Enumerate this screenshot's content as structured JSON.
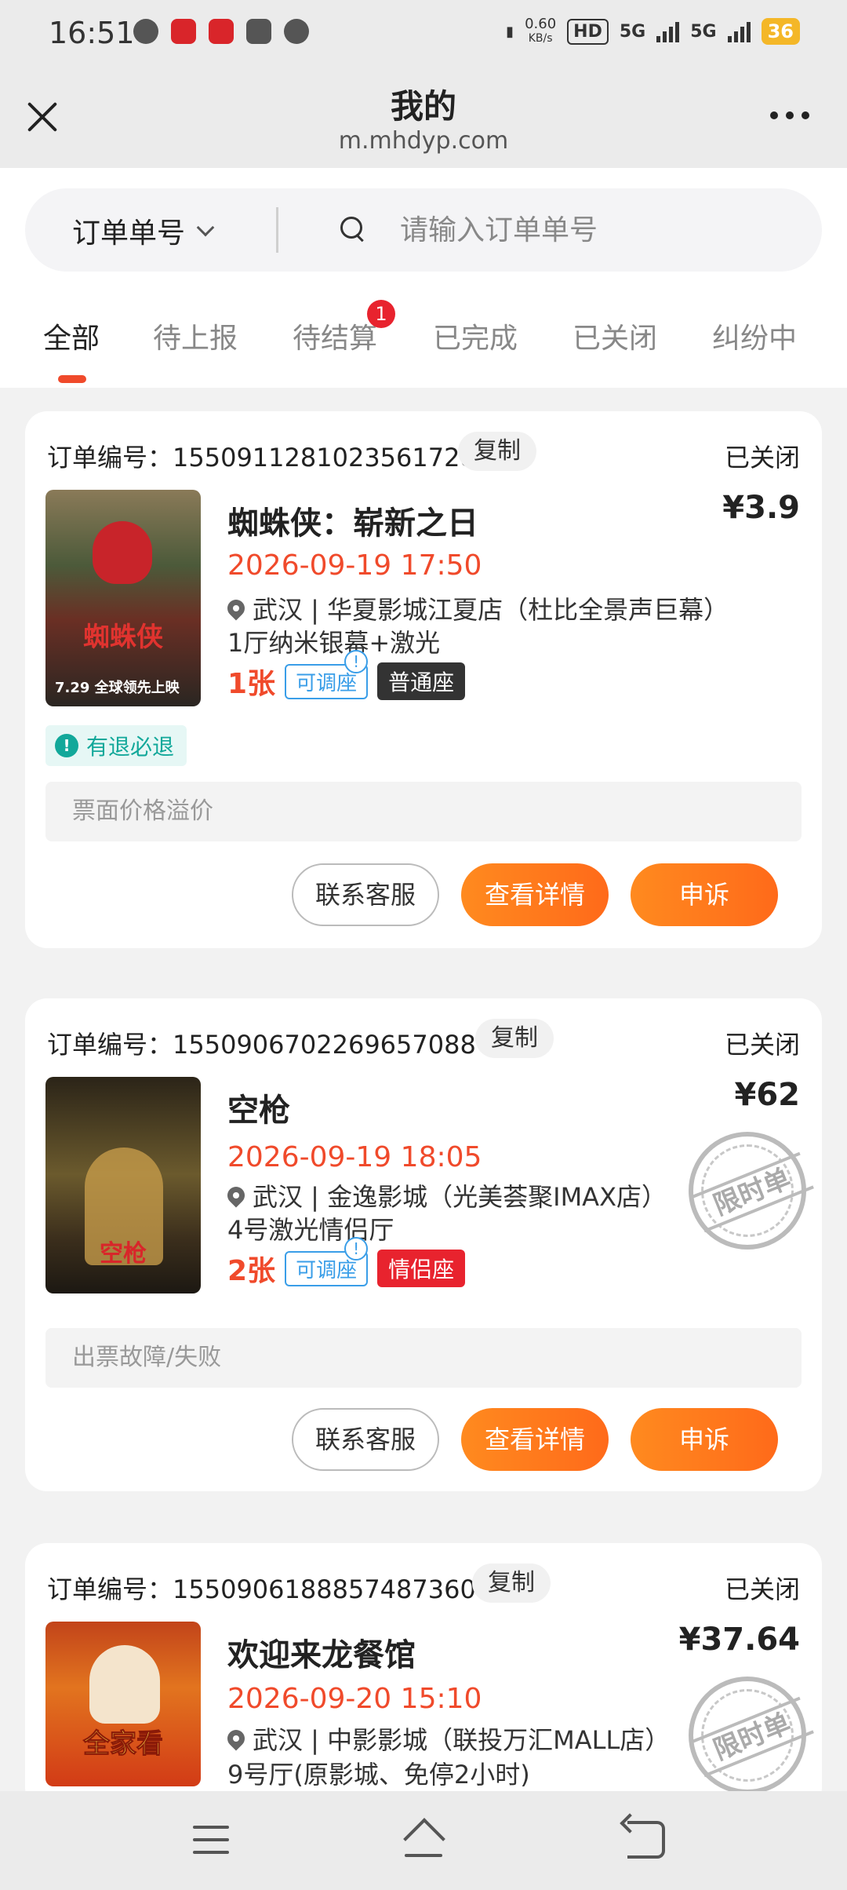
{
  "status_bar": {
    "time": "16:51",
    "net_speed": "0.60",
    "net_unit": "KB/s",
    "hd": "HD",
    "sig1": "5G",
    "sig2": "5G",
    "battery": "36"
  },
  "header": {
    "title": "我的",
    "url": "m.mhdyp.com"
  },
  "search": {
    "type_label": "订单单号",
    "placeholder": "请输入订单单号"
  },
  "tabs": [
    {
      "label": "全部"
    },
    {
      "label": "待上报"
    },
    {
      "label": "待结算",
      "badge": "1"
    },
    {
      "label": "已完成"
    },
    {
      "label": "已关闭"
    },
    {
      "label": "纠纷中"
    }
  ],
  "orders": [
    {
      "order_label": "订单编号：1550911281023561728",
      "copy": "复制",
      "status": "已关闭",
      "movie": "蜘蛛侠：崭新之日",
      "price": "¥3.9",
      "showtime": "2026-09-19 17:50",
      "cinema": "武汉 | 华夏影城江夏店（杜比全景声巨幕）",
      "hall": "1厅纳米银幕+激光",
      "qty": "1张",
      "adjust_tag": "可调座",
      "seat_tag": "普通座",
      "seat_color": "#333333",
      "refund": "有退必退",
      "reason": "票面价格溢价",
      "poster_text": "蜘蛛侠",
      "poster_date": "7.29 全球领先上映"
    },
    {
      "order_label": "订单编号：1550906702269657088",
      "copy": "复制",
      "status": "已关闭",
      "movie": "空枪",
      "price": "¥62",
      "showtime": "2026-09-19 18:05",
      "cinema": "武汉 | 金逸影城（光美荟聚IMAX店）",
      "hall": "4号激光情侣厅",
      "qty": "2张",
      "adjust_tag": "可调座",
      "seat_tag": "情侣座",
      "seat_color": "#e8232e",
      "stamp": "限时单",
      "reason": "出票故障/失败",
      "poster_text": "空枪"
    },
    {
      "order_label": "订单编号：1550906188857487360",
      "copy": "复制",
      "status": "已关闭",
      "movie": "欢迎来龙餐馆",
      "price": "¥37.64",
      "showtime": "2026-09-20 15:10",
      "cinema": "武汉 | 中影影城（联投万汇MALL店）",
      "hall": "9号厅(原影城、免停2小时)",
      "stamp": "限时单",
      "poster_text": "全家看"
    }
  ],
  "actions": {
    "contact": "联系客服",
    "details": "查看详情",
    "appeal": "申诉"
  },
  "colors": {
    "accent": "#f04a2b",
    "button_orange": "#ff7a1c",
    "refund_teal": "#12a89a",
    "info_blue": "#3a9ee8"
  },
  "nav": {
    "menu_icon": "menu-icon",
    "home_icon": "home-icon",
    "back_icon": "back-icon"
  }
}
